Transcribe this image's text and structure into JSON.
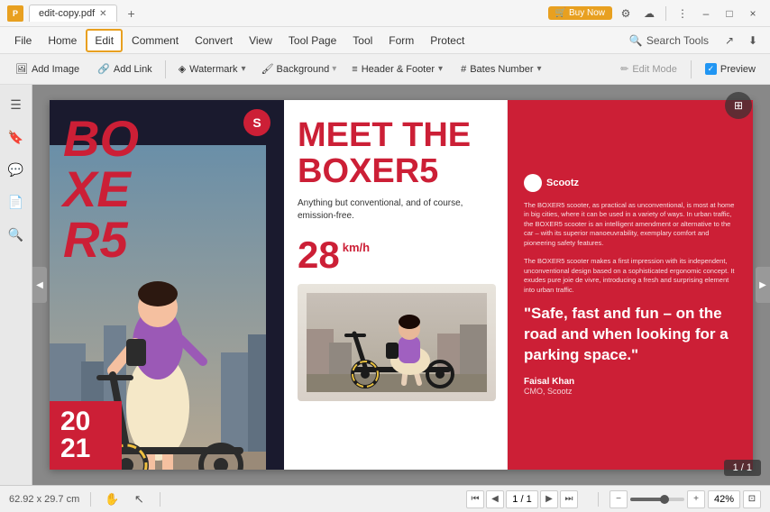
{
  "titlebar": {
    "app_icon_label": "P",
    "filename": "edit-copy.pdf",
    "buy_now_label": "Buy Now",
    "close_label": "×",
    "min_label": "–",
    "max_label": "□"
  },
  "menubar": {
    "file_label": "File",
    "home_label": "Home",
    "edit_label": "Edit",
    "comment_label": "Comment",
    "convert_label": "Convert",
    "view_label": "View",
    "page_label": "Tool Page",
    "tool_label": "Tool",
    "form_label": "Form",
    "protect_label": "Protect",
    "search_tools_label": "Search Tools"
  },
  "toolbar": {
    "add_image_label": "Add Image",
    "add_link_label": "Add Link",
    "watermark_label": "Watermark",
    "background_label": "Background",
    "header_footer_label": "Header & Footer",
    "bates_number_label": "Bates Number",
    "edit_mode_label": "Edit Mode",
    "preview_label": "Preview"
  },
  "pdf": {
    "boxer5_title": "BOXER5",
    "meet_the": "MEET THE BOXER5",
    "tagline": "Anything but conventional, and\nof course, emission-free.",
    "speed": "28",
    "speed_unit": "km/h",
    "year": "20\n21",
    "scootz_name": "Scootz",
    "desc1": "The BOXER5 scooter, as practical as unconventional, is most at home in big cities, where it can be used in a variety of ways. In urban traffic, the BOXER5 scooter is an intelligent amendment or alternative to the car – with its superior manoeuvrability, exemplary comfort and pioneering safety features.",
    "desc2": "The BOXER5 scooter makes a first impression with its independent, unconventional design based on a sophisticated ergonomic concept. It exudes pure joie de vivre, introducing a fresh and surprising element into urban traffic.",
    "quote": "\"Safe, fast and fun – on the road and when looking for a parking space.\"",
    "author_name": "Faisal Khan",
    "author_title": "CMO, Scootz"
  },
  "statusbar": {
    "dimensions": "62.92 x 29.7 cm",
    "page_info": "1 / 1",
    "zoom_value": "42%"
  },
  "icons": {
    "left_panel": "☰",
    "bookmark": "🔖",
    "comment": "💬",
    "pages": "📄",
    "search": "🔍",
    "chevron_left": "◀",
    "chevron_right": "▶",
    "first_page": "⏮",
    "last_page": "⏭",
    "zoom_out": "−",
    "zoom_in": "+",
    "fit_page": "⊡"
  }
}
